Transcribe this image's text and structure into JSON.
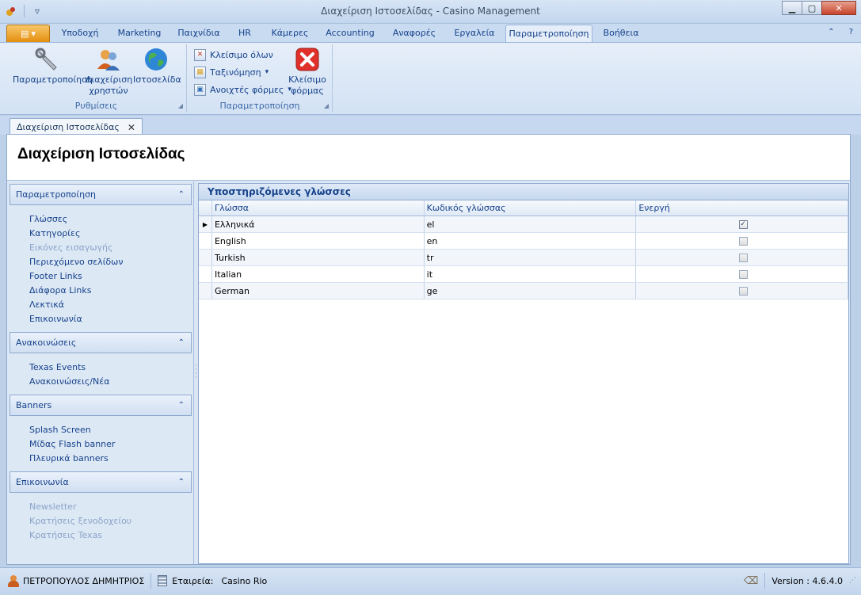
{
  "window": {
    "title": "Διαχείριση Ιστοσελίδας - Casino Management"
  },
  "ribbon_tabs": [
    "Υποδοχή",
    "Marketing",
    "Παιχνίδια",
    "HR",
    "Κάμερες",
    "Accounting",
    "Αναφορές",
    "Εργαλεία",
    "Παραμετροποίηση",
    "Βοήθεια"
  ],
  "active_tab": "Παραμετροποίηση",
  "ribbon": {
    "group1": {
      "label": "Ρυθμίσεις",
      "buttons": [
        {
          "line1": "Παραμετροποίηση",
          "line2": "",
          "icon": "wrench-icon"
        },
        {
          "line1": "Διαχείριση",
          "line2": "χρηστών",
          "icon": "users-icon"
        },
        {
          "line1": "Ιστοσελίδα",
          "line2": "",
          "icon": "globe-icon"
        }
      ]
    },
    "group2": {
      "label": "Παραμετροποίηση",
      "small_buttons": [
        {
          "label": "Κλείσιμο όλων",
          "icon": "close-all-icon"
        },
        {
          "label": "Ταξινόμηση",
          "icon": "arrange-icon",
          "dropdown": "▾"
        },
        {
          "label": "Ανοιχτές φόρμες",
          "icon": "open-forms-icon",
          "dropdown": "▾"
        }
      ],
      "close_form": {
        "line1": "Κλείσιμο",
        "line2": "φόρμας",
        "icon": "red-x-icon"
      }
    }
  },
  "document_tab": {
    "label": "Διαχείριση Ιστοσελίδας"
  },
  "page": {
    "title": "Διαχείριση Ιστοσελίδας"
  },
  "nav": {
    "groups": [
      {
        "title": "Παραμετροποίηση",
        "items": [
          {
            "label": "Γλώσσες",
            "enabled": true
          },
          {
            "label": "Κατηγορίες",
            "enabled": true
          },
          {
            "label": "Εικόνες εισαγωγής",
            "enabled": false
          },
          {
            "label": "Περιεχόμενο σελίδων",
            "enabled": true
          },
          {
            "label": "Footer Links",
            "enabled": true
          },
          {
            "label": "Διάφορα Links",
            "enabled": true
          },
          {
            "label": "Λεκτικά",
            "enabled": true
          },
          {
            "label": "Επικοινωνία",
            "enabled": true
          }
        ]
      },
      {
        "title": "Ανακοινώσεις",
        "items": [
          {
            "label": "Texas Events",
            "enabled": true
          },
          {
            "label": "Ανακοινώσεις/Νέα",
            "enabled": true
          }
        ]
      },
      {
        "title": "Banners",
        "items": [
          {
            "label": "Splash Screen",
            "enabled": true
          },
          {
            "label": "Μίδας Flash banner",
            "enabled": true
          },
          {
            "label": "Πλευρικά banners",
            "enabled": true
          }
        ]
      },
      {
        "title": "Επικοινωνία",
        "items": [
          {
            "label": "Newsletter",
            "enabled": false
          },
          {
            "label": "Κρατήσεις ξενοδοχείου",
            "enabled": false
          },
          {
            "label": "Κρατήσεις Texas",
            "enabled": false
          }
        ]
      }
    ]
  },
  "grid": {
    "title": "Υποστηριζόμενες γλώσσες",
    "columns": [
      "Γλώσσα",
      "Κωδικός γλώσσας",
      "Ενεργή"
    ],
    "rows": [
      {
        "language": "Ελληνικά",
        "code": "el",
        "active": true,
        "selected": true
      },
      {
        "language": "English",
        "code": "en",
        "active": false,
        "selected": false
      },
      {
        "language": "Turkish",
        "code": "tr",
        "active": false,
        "selected": false
      },
      {
        "language": "Italian",
        "code": "it",
        "active": false,
        "selected": false
      },
      {
        "language": "German",
        "code": "ge",
        "active": false,
        "selected": false
      }
    ]
  },
  "status_bar": {
    "user": "ΠΕΤΡΟΠΟΥΛΟΣ ΔΗΜΗΤΡΙΟΣ",
    "company_label": "Εταιρεία:",
    "company_value": "Casino Rio",
    "version": "Version : 4.6.4.0"
  },
  "colors": {
    "accent": "#15428b",
    "app_menu": "#e58f0e",
    "close_red": "#c8432a"
  }
}
